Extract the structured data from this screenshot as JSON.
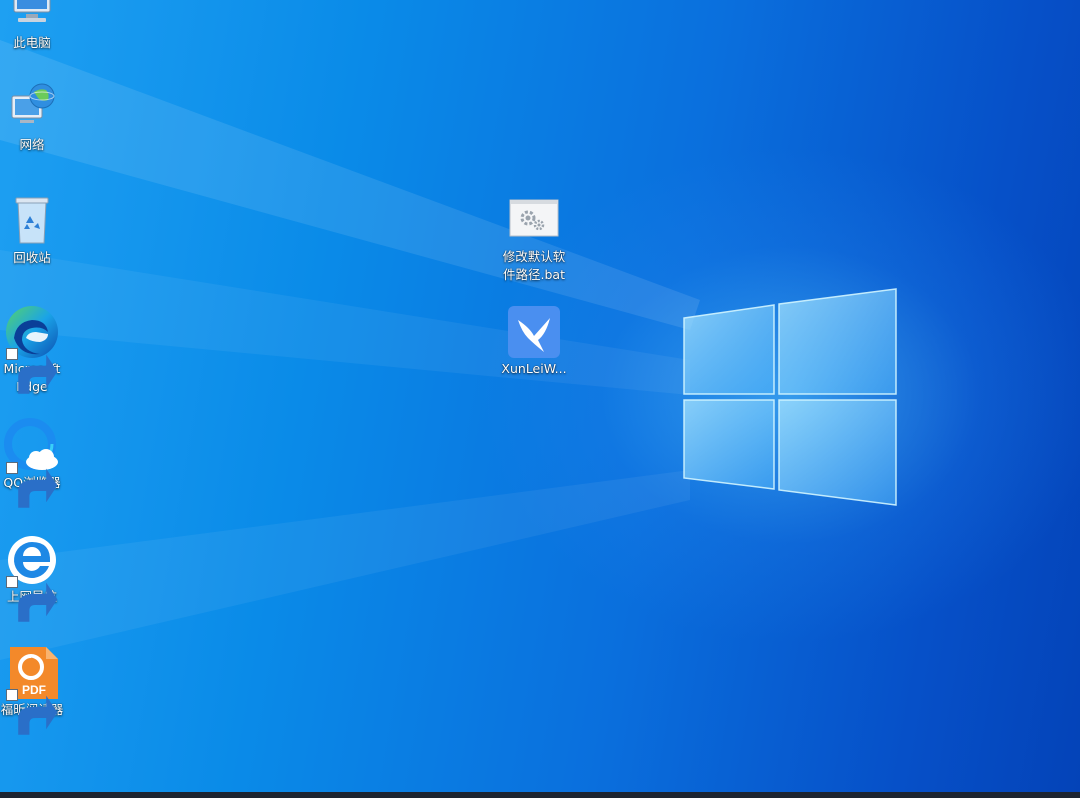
{
  "desktop": {
    "icons": [
      {
        "label": "此电脑",
        "icon": "computer-icon"
      },
      {
        "label": "网络",
        "icon": "network-globe-icon"
      },
      {
        "label": "回收站",
        "icon": "recycle-bin-icon"
      },
      {
        "label": "Microsoft\nEdge",
        "icon": "edge-browser-icon"
      },
      {
        "label": "QQ浏览器",
        "icon": "qq-browser-icon"
      },
      {
        "label": "上网导航",
        "icon": "ie-browser-icon"
      },
      {
        "label": "福昕阅读器",
        "icon": "foxit-pdf-icon"
      },
      {
        "label": "修改默认软件路径.bat",
        "icon": "batch-file-gear-icon"
      },
      {
        "label": "XunLeiW...",
        "icon": "xunlei-bird-icon"
      }
    ]
  },
  "colors": {
    "wallpaper_light": "#1ea0f2",
    "wallpaper_dark": "#0443b8",
    "taskbar": "#1d2430"
  }
}
